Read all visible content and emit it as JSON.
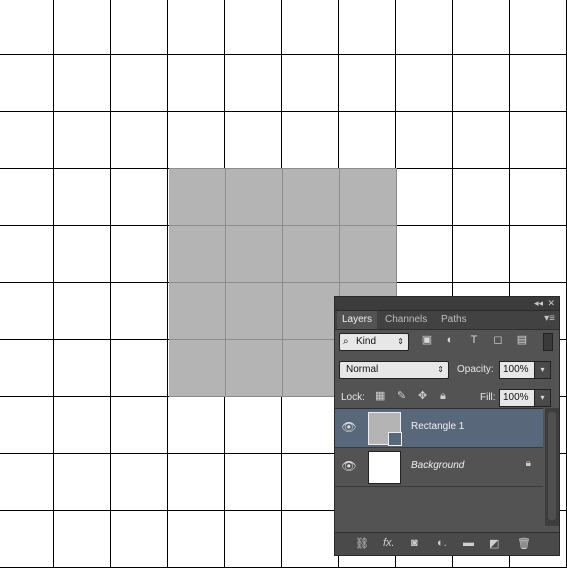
{
  "panel": {
    "tabs": [
      "Layers",
      "Channels",
      "Paths"
    ],
    "filter": {
      "kind_label": "Kind"
    },
    "blend": {
      "mode": "Normal",
      "opacity_label": "Opacity:",
      "opacity_value": "100%"
    },
    "lock": {
      "label": "Lock:",
      "fill_label": "Fill:",
      "fill_value": "100%"
    },
    "layers": [
      {
        "name": "Rectangle 1",
        "selected": true
      },
      {
        "name": "Background",
        "locked": true
      }
    ]
  },
  "canvas": {
    "rect_color": "#b4b4b4",
    "grid_color": "#000000"
  },
  "icons": [
    "collapse-icon",
    "close-icon",
    "panel-menu-icon",
    "search-icon",
    "image-filter-icon",
    "adjustment-filter-icon",
    "type-filter-icon",
    "shape-filter-icon",
    "smart-object-filter-icon",
    "eye-icon",
    "lock-icon",
    "link-icon",
    "fx-icon",
    "mask-icon",
    "new-adjustment-icon",
    "folder-icon",
    "new-layer-icon",
    "trash-icon"
  ]
}
